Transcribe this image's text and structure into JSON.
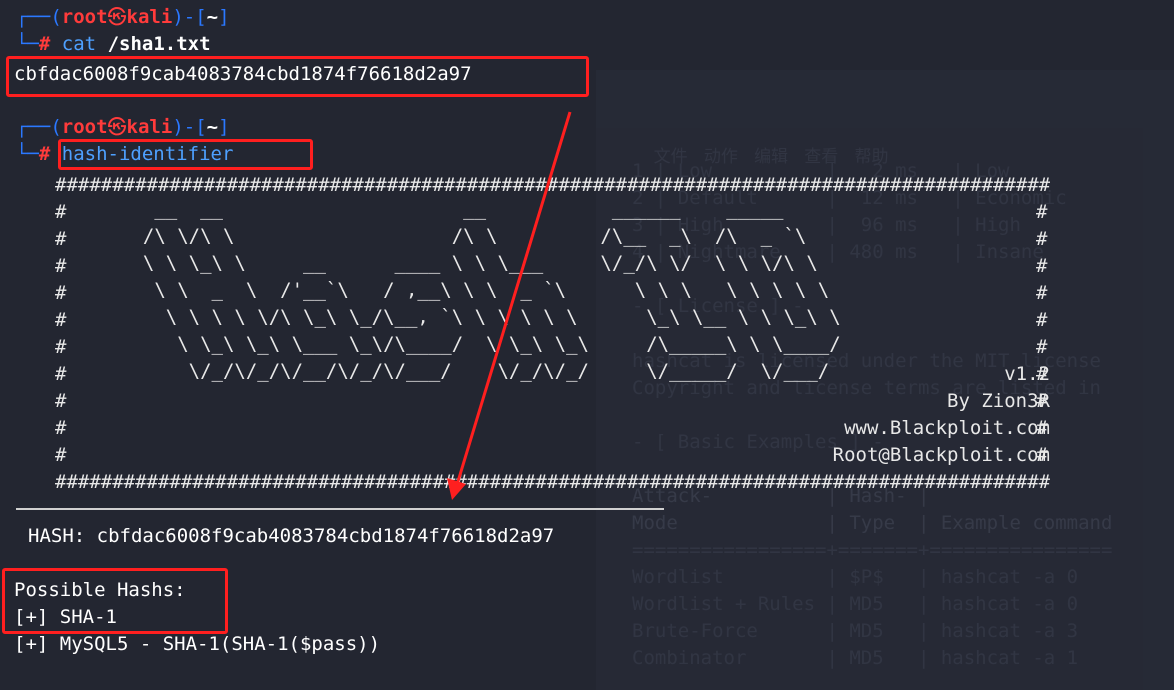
{
  "background_window": {
    "menu": [
      "文件",
      "动作",
      "编辑",
      "查看",
      "帮助"
    ],
    "lines": [
      "1 | Low          |   2 ms   | Low",
      "2 | Default      |  12 ms   | Economic",
      "3 | High         |  96 ms   | High",
      "4 | Nightmare    | 480 ms   | Insane",
      "- [ License ] -",
      "hashcat is licensed under the MIT license",
      "Copyright and license terms are listed in",
      "- [ Basic Examples ] -",
      "Attack-          | Hash- |",
      "Mode             | Type  | Example command",
      "=================+=======+================",
      "Wordlist         | $P$   | hashcat -a 0",
      "Wordlist + Rules | MD5   | hashcat -a 0",
      "Brute-Force      | MD5   | hashcat -a 3",
      "Combinator       | MD5   | hashcat -a 1"
    ]
  },
  "prompt": {
    "user": "root",
    "skull": "㉿",
    "host": "kali",
    "dir": "~",
    "symbol": "#"
  },
  "command1": {
    "name": "cat",
    "arg": "/sha1.txt"
  },
  "output1": "cbfdac6008f9cab4083784cbd1874f76618d2a97",
  "command2": {
    "name": "hash-identifier"
  },
  "banner": {
    "border": "######################################################################################################",
    "ascii": [
      "   __  __                     __           ______    _____",
      "  /\\ \\/\\ \\                   /\\ \\         /\\__  _\\  /\\  _ `\\",
      "  \\ \\ \\_\\ \\     __      ____ \\ \\ \\___     \\/_/\\ \\/  \\ \\ \\/\\ \\",
      "   \\ \\  _  \\  /'__`\\   / ,__\\ \\ \\  _ `\\      \\ \\ \\   \\ \\ \\ \\ \\",
      "    \\ \\ \\ \\ \\/\\ \\_\\ \\_/\\__, `\\ \\ \\ \\ \\ \\      \\_\\ \\__ \\ \\ \\_\\ \\",
      "     \\ \\_\\ \\_\\ \\___ \\_\\/\\____/  \\ \\_\\ \\_\\     /\\_____\\ \\ \\____/",
      "      \\/_/\\/_/\\/__/\\/_/\\/___/    \\/_/\\/_/     \\/_____/  \\/___/"
    ],
    "version": "v1.2",
    "author": "By Zion3R",
    "site": "www.Blackploit.com",
    "email": "Root@Blackploit.com"
  },
  "hash_line": {
    "label": "HASH:",
    "value": "cbfdac6008f9cab4083784cbd1874f76618d2a97"
  },
  "possible": {
    "title": "Possible Hashs:",
    "items": [
      "[+] SHA-1",
      "[+] MySQL5 - SHA-1(SHA-1($pass))"
    ]
  },
  "colors": {
    "background": "#232631",
    "prompt_blue": "#2b78ff",
    "prompt_red": "#ff3b3b",
    "annotation_red": "#ff1f1f"
  }
}
